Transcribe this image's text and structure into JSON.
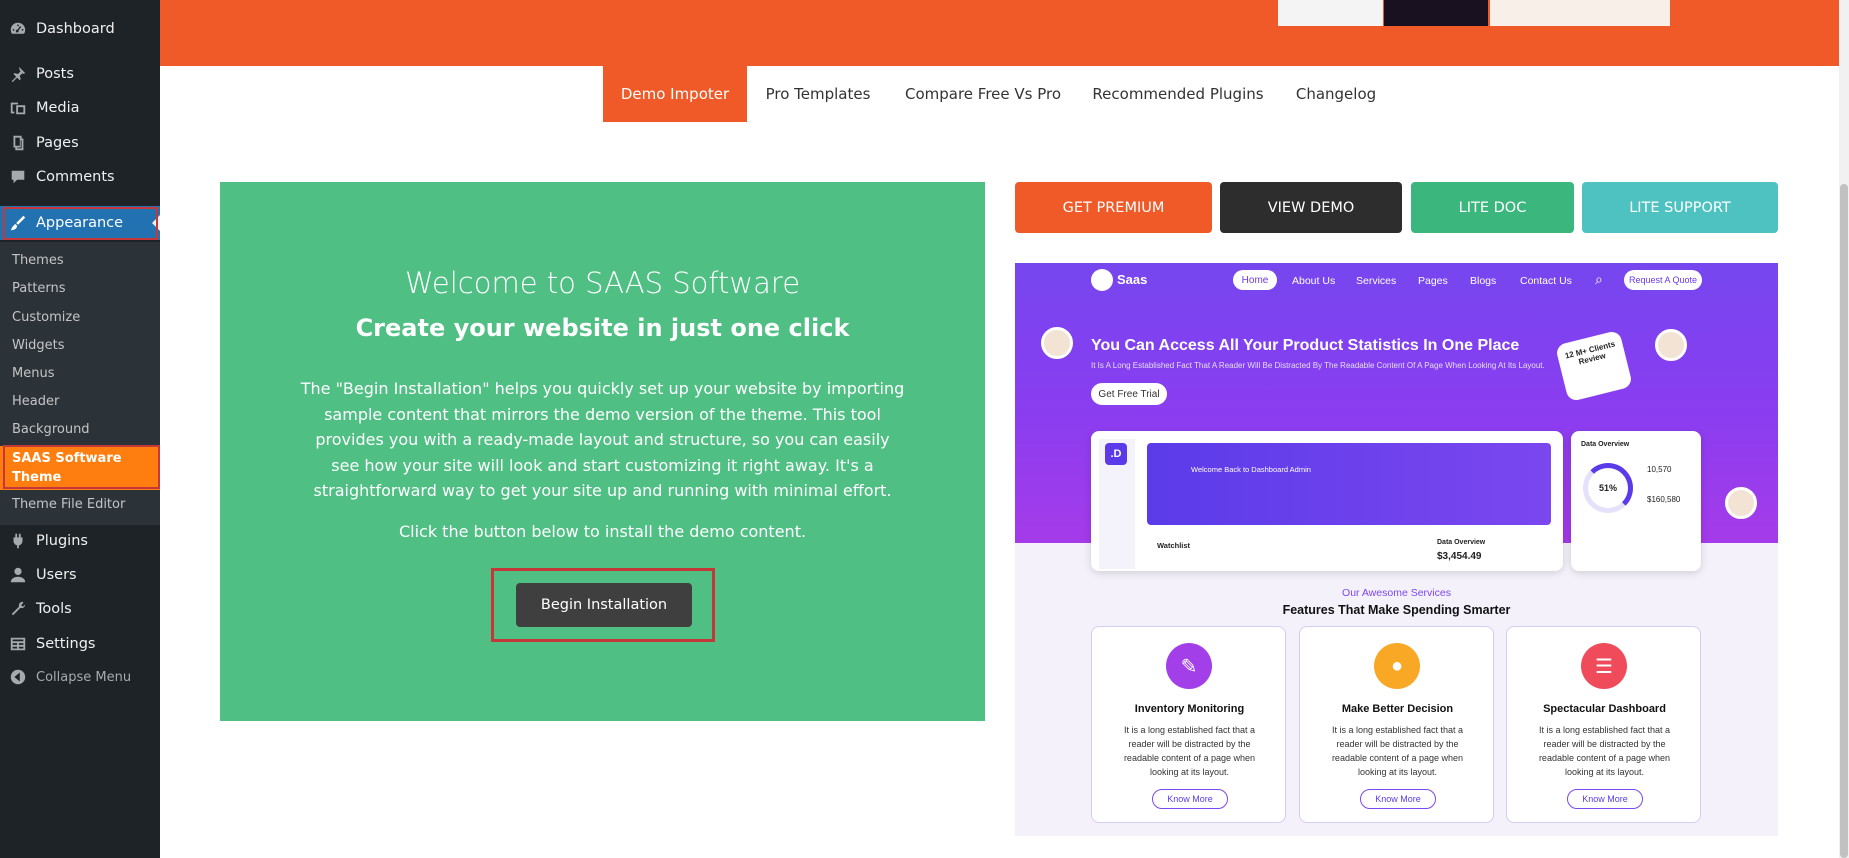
{
  "sidebar": {
    "top_items": [
      {
        "label": "Dashboard"
      },
      {
        "label": "Posts"
      },
      {
        "label": "Media"
      },
      {
        "label": "Pages"
      },
      {
        "label": "Comments"
      },
      {
        "label": "Appearance"
      }
    ],
    "submenu": [
      {
        "label": "Themes"
      },
      {
        "label": "Patterns"
      },
      {
        "label": "Customize"
      },
      {
        "label": "Widgets"
      },
      {
        "label": "Menus"
      },
      {
        "label": "Header"
      },
      {
        "label": "Background"
      },
      {
        "label": "SAAS Software Theme"
      },
      {
        "label": "Theme File Editor"
      }
    ],
    "bottom_items": [
      {
        "label": "Plugins"
      },
      {
        "label": "Users"
      },
      {
        "label": "Tools"
      },
      {
        "label": "Settings"
      },
      {
        "label": "Collapse Menu"
      }
    ],
    "active_color": "#2271b1",
    "current_sub_color": "#ff7e0f"
  },
  "tabs": [
    {
      "label": "Demo Impoter",
      "active": true
    },
    {
      "label": "Pro Templates"
    },
    {
      "label": "Compare Free Vs Pro"
    },
    {
      "label": "Recommended Plugins"
    },
    {
      "label": "Changelog"
    }
  ],
  "welcome": {
    "title": "Welcome to SAAS Software",
    "subtitle": "Create your website in just one click",
    "description": "The \"Begin Installation\" helps you quickly set up your website by importing sample content that mirrors the demo version of the theme. This tool provides you with a ready-made layout and structure, so you can easily see how your site will look and start customizing it right away. It's a straightforward way to get your site up and running with minimal effort.",
    "click_text": "Click the button below to install the demo content.",
    "button_label": "Begin Installation",
    "bg_color": "#50bf84"
  },
  "actions": [
    {
      "label": "GET PREMIUM",
      "color": "#f05a28"
    },
    {
      "label": "VIEW DEMO",
      "color": "#2d2d2d"
    },
    {
      "label": "LITE DOC",
      "color": "#3bb77e"
    },
    {
      "label": "LITE SUPPORT",
      "color": "#4ec2c0"
    }
  ],
  "preview": {
    "logo": "Saas",
    "nav": [
      "Home",
      "About Us",
      "Services",
      "Pages",
      "Blogs",
      "Contact Us"
    ],
    "quote_button": "Request A Quote",
    "headline": "You Can Access All Your Product Statistics In One Place",
    "tagline": "It Is A Long Established Fact That A Reader Will Be Distracted By The Readable Content Of A Page When Looking At Its Layout.",
    "trial_button": "Get Free Trial",
    "clients_badge": "12 M+ Clients Review",
    "dashboard": {
      "logo": ".D",
      "welcome": "Welcome Back to Dashboard Admin",
      "watchlist": "Watchlist",
      "overview": "Data Overview",
      "amount": "$3,454.49"
    },
    "side_panel": {
      "title": "Data Overview",
      "percent": "51%",
      "value1": "10,570",
      "value2": "$160,580"
    },
    "services_label": "Our Awesome Services",
    "services_title": "Features That Make Spending Smarter",
    "cards": [
      {
        "title": "Inventory Monitoring",
        "desc": "It is a long established fact that a reader will be distracted by the readable content of a page when looking at its layout.",
        "more": "Know More",
        "color": "#a23fe8"
      },
      {
        "title": "Make Better Decision",
        "desc": "It is a long established fact that a reader will be distracted by the readable content of a page when looking at its layout.",
        "more": "Know More",
        "color": "#f8a824"
      },
      {
        "title": "Spectacular Dashboard",
        "desc": "It is a long established fact that a reader will be distracted by the readable content of a page when looking at its layout.",
        "more": "Know More",
        "color": "#ef4b5b"
      }
    ]
  },
  "colors": {
    "banner": "#f05a28",
    "highlight_border": "#c5383a"
  }
}
